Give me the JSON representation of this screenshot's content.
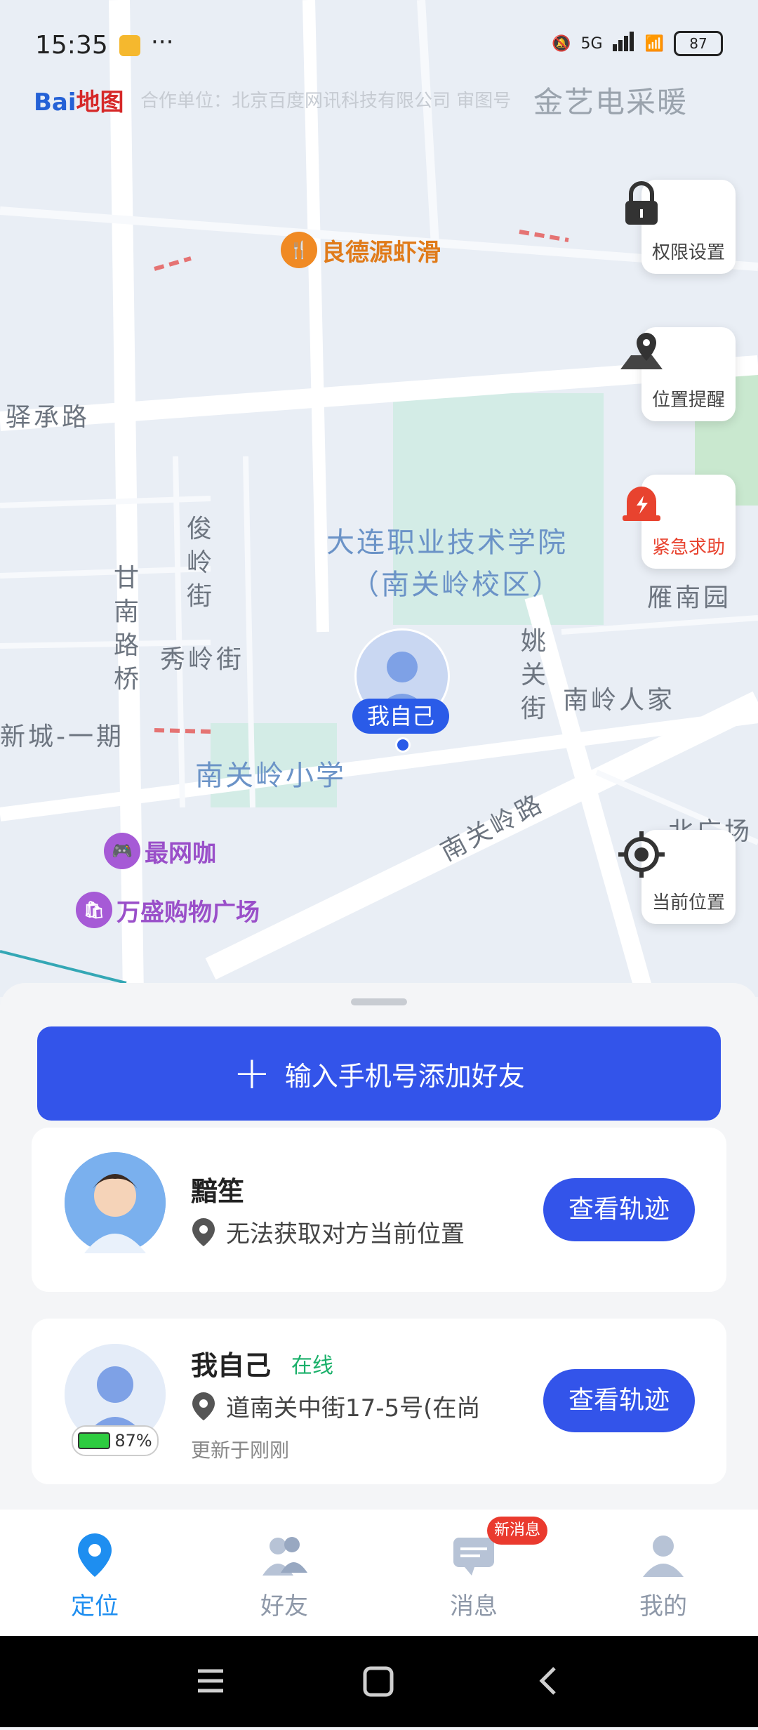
{
  "status": {
    "time": "15:35",
    "network": "5G",
    "battery": "87"
  },
  "map": {
    "provider_logo": {
      "brand": "Bai",
      "suffix": "地图"
    },
    "partner_text": "合作单位：北京百度网讯科技有限公司 审图号",
    "watermark": "金艺电采暖",
    "labels": {
      "yicheng_road": "驿承路",
      "gannan_bridge": "甘南路桥",
      "junling_street": "俊岭街",
      "xiuling_street": "秀岭街",
      "xincheng": "新城-一期",
      "college": "大连职业技术学院",
      "college_campus": "（南关岭校区）",
      "yaoguan_street": "姚关街",
      "nanling_home": "南岭人家",
      "yannan_garden": "雁南园",
      "school": "南关岭小学",
      "nanguanling_road": "南关岭路",
      "beiguang": "北广场"
    },
    "pois": {
      "shrimp": "良德源虾滑",
      "netcafe": "最网咖",
      "mall": "万盛购物广场"
    },
    "self_marker_label": "我自己"
  },
  "side_buttons": {
    "permissions": "权限设置",
    "location_alert": "位置提醒",
    "sos": "紧急求助",
    "current_location": "当前位置"
  },
  "add_friend_label": "输入手机号添加好友",
  "friends": [
    {
      "name": "黯笙",
      "location": "无法获取对方当前位置",
      "track_label": "查看轨迹"
    },
    {
      "name": "我自己",
      "status": "在线",
      "location": "道南关中街17-5号(在尚",
      "updated": "更新于刚刚",
      "battery": "87%",
      "track_label": "查看轨迹"
    }
  ],
  "tabs": [
    {
      "label": "定位",
      "icon": "location-pin-icon",
      "active": true
    },
    {
      "label": "好友",
      "icon": "friends-icon"
    },
    {
      "label": "消息",
      "icon": "message-icon",
      "badge": "新消息"
    },
    {
      "label": "我的",
      "icon": "profile-icon"
    }
  ],
  "colors": {
    "primary": "#3354ea",
    "online": "#1ab06a",
    "sos": "#e8432f",
    "badge": "#ea3a2e"
  }
}
